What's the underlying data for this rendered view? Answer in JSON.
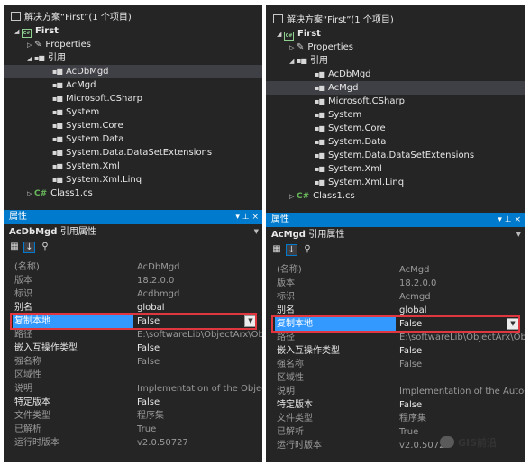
{
  "panels": [
    {
      "solution_title": "解决方案“First”(1 个项目)",
      "project": "First",
      "properties_node": "Properties",
      "references_node": "引用",
      "references": [
        "AcDbMgd",
        "AcMgd",
        "Microsoft.CSharp",
        "System",
        "System.Core",
        "System.Data",
        "System.Data.DataSetExtensions",
        "System.Xml",
        "System.Xml.Linq"
      ],
      "class_file": "Class1.cs",
      "props_window_title": "属性",
      "props_buttons": "▾ ⊥ ×",
      "object_name": "AcDbMgd",
      "object_kind": "引用属性",
      "rows": [
        {
          "n": "(名称)",
          "v": "AcDbMgd"
        },
        {
          "n": "版本",
          "v": "18.2.0.0"
        },
        {
          "n": "标识",
          "v": "Acdbmgd"
        },
        {
          "n": "别名",
          "v": "global"
        },
        {
          "n": "复制本地",
          "v": "False"
        },
        {
          "n": "路径",
          "v": "E:\\softwareLib\\ObjectArx\\Objec"
        },
        {
          "n": "嵌入互操作类型",
          "v": "False"
        },
        {
          "n": "强名称",
          "v": "False"
        },
        {
          "n": "区域性",
          "v": ""
        },
        {
          "n": "说明",
          "v": "Implementation of the ObjectD"
        },
        {
          "n": "特定版本",
          "v": "False"
        },
        {
          "n": "文件类型",
          "v": "程序集"
        },
        {
          "n": "已解析",
          "v": "True"
        },
        {
          "n": "运行时版本",
          "v": "v2.0.50727"
        }
      ]
    },
    {
      "solution_title": "解决方案“First”(1 个项目)",
      "project": "First",
      "properties_node": "Properties",
      "references_node": "引用",
      "references": [
        "AcDbMgd",
        "AcMgd",
        "Microsoft.CSharp",
        "System",
        "System.Core",
        "System.Data",
        "System.Data.DataSetExtensions",
        "System.Xml",
        "System.Xml.Linq"
      ],
      "class_file": "Class1.cs",
      "props_window_title": "属性",
      "props_buttons": "▾ ⊥ ×",
      "object_name": "AcMgd",
      "object_kind": "引用属性",
      "rows": [
        {
          "n": "(名称)",
          "v": "AcMgd"
        },
        {
          "n": "版本",
          "v": "18.2.0.0"
        },
        {
          "n": "标识",
          "v": "Acmgd"
        },
        {
          "n": "别名",
          "v": "global"
        },
        {
          "n": "复制本地",
          "v": "False"
        },
        {
          "n": "路径",
          "v": "E:\\softwareLib\\ObjectArx\\Obje"
        },
        {
          "n": "嵌入互操作类型",
          "v": "False"
        },
        {
          "n": "强名称",
          "v": "False"
        },
        {
          "n": "区域性",
          "v": ""
        },
        {
          "n": "说明",
          "v": "Implementation of the AutoCAI"
        },
        {
          "n": "特定版本",
          "v": "False"
        },
        {
          "n": "文件类型",
          "v": "程序集"
        },
        {
          "n": "已解析",
          "v": "True"
        },
        {
          "n": "运行时版本",
          "v": "v2.0.50727"
        }
      ]
    }
  ],
  "watermark": "GIS前沿",
  "colors": {
    "accent": "#007acc",
    "highlight": "#3399ff",
    "annotation": "#e0363f",
    "background": "#252526"
  }
}
